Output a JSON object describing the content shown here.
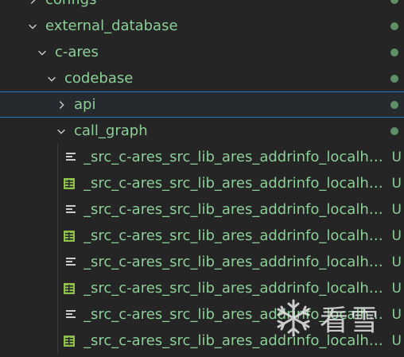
{
  "tree": {
    "folders": [
      {
        "label": "configs",
        "expanded": false
      },
      {
        "label": "external_database",
        "expanded": true
      },
      {
        "label": "c-ares",
        "expanded": true
      },
      {
        "label": "codebase",
        "expanded": true
      },
      {
        "label": "api",
        "expanded": false
      },
      {
        "label": "call_graph",
        "expanded": true
      }
    ],
    "files": [
      {
        "name": "_src_c-ares_src_lib_ares_addrinfo_localhost...",
        "icon": "text-file-icon",
        "status": "U"
      },
      {
        "name": "_src_c-ares_src_lib_ares_addrinfo_localhost...",
        "icon": "table-file-icon",
        "status": "U"
      },
      {
        "name": "_src_c-ares_src_lib_ares_addrinfo_localhost...",
        "icon": "text-file-icon",
        "status": "U"
      },
      {
        "name": "_src_c-ares_src_lib_ares_addrinfo_localhost...",
        "icon": "table-file-icon",
        "status": "U"
      },
      {
        "name": "_src_c-ares_src_lib_ares_addrinfo_localhost...",
        "icon": "text-file-icon",
        "status": "U"
      },
      {
        "name": "_src_c-ares_src_lib_ares_addrinfo_localhost...",
        "icon": "table-file-icon",
        "status": "U"
      },
      {
        "name": "_src_c-ares_src_lib_ares_addrinfo_localhost...",
        "icon": "text-file-icon",
        "status": "U"
      },
      {
        "name": "_src_c-ares_src_lib_ares_addrinfo_localhost...",
        "icon": "table-file-icon",
        "status": "U"
      }
    ]
  },
  "watermark": {
    "text": "看雪",
    "icon": "snowflake-icon"
  },
  "colors": {
    "accent": "#2b79c2",
    "untracked": "#8ccf97",
    "background": "#252526",
    "dot": "#5f8f66"
  }
}
